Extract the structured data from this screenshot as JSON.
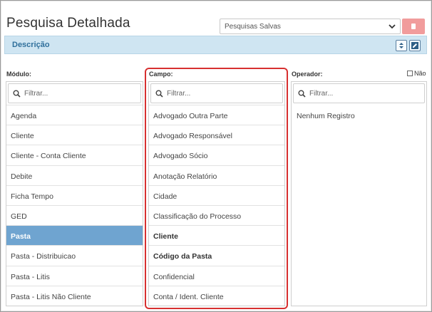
{
  "header": {
    "title": "Pesquisa Detalhada",
    "saved_searches_value": "Pesquisas Salvas"
  },
  "description_bar": {
    "label": "Descrição"
  },
  "modulo": {
    "label": "Módulo:",
    "filter_placeholder": "Filtrar...",
    "items": [
      "Agenda",
      "Cliente",
      "Cliente - Conta Cliente",
      "Debite",
      "Ficha Tempo",
      "GED",
      "Pasta",
      "Pasta - Distribuicao",
      "Pasta - Litis",
      "Pasta - Litis Não Cliente"
    ],
    "selected": "Pasta"
  },
  "campo": {
    "label": "Campo:",
    "filter_placeholder": "Filtrar...",
    "items": [
      "Advogado Outra Parte",
      "Advogado Responsável",
      "Advogado Sócio",
      "Anotação Relatório",
      "Cidade",
      "Classificação do Processo",
      "Cliente",
      "Código da Pasta",
      "Confidencial",
      "Conta / Ident. Cliente"
    ],
    "bold_items": [
      "Cliente",
      "Código da Pasta"
    ]
  },
  "operador": {
    "label": "Operador:",
    "filter_placeholder": "Filtrar...",
    "nao_label": "Não",
    "nao_checked": false,
    "empty_text": "Nenhum Registro"
  },
  "colors": {
    "accent_blue": "#6fa4d0",
    "description_bar": "#cfe5f2",
    "delete_button": "#f19c9c",
    "highlight_red": "#d73030"
  }
}
